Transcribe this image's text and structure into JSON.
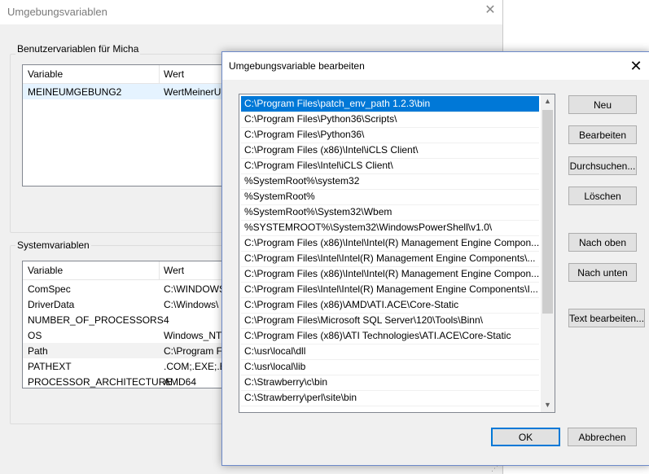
{
  "background_window": {
    "title": "Umgebungsvariablen",
    "user_group_label": "Benutzervariablen für Micha",
    "user_columns": [
      "Variable",
      "Wert"
    ],
    "user_rows": [
      {
        "variable": "MEINEUMGEBUNG2",
        "value": "WertMeinerU"
      }
    ],
    "system_group_label": "Systemvariablen",
    "system_columns": [
      "Variable",
      "Wert"
    ],
    "system_rows": [
      {
        "variable": "ComSpec",
        "value": "C:\\WINDOWS"
      },
      {
        "variable": "DriverData",
        "value": "C:\\Windows\\"
      },
      {
        "variable": "NUMBER_OF_PROCESSORS",
        "value": "4"
      },
      {
        "variable": "OS",
        "value": "Windows_NT"
      },
      {
        "variable": "Path",
        "value": "C:\\Program F"
      },
      {
        "variable": "PATHEXT",
        "value": ".COM;.EXE;.B"
      },
      {
        "variable": "PROCESSOR_ARCHITECTURE",
        "value": "AMD64"
      }
    ]
  },
  "dialog": {
    "title": "Umgebungsvariable bearbeiten",
    "paths": [
      "C:\\Program Files\\patch_env_path 1.2.3\\bin",
      "C:\\Program Files\\Python36\\Scripts\\",
      "C:\\Program Files\\Python36\\",
      "C:\\Program Files (x86)\\Intel\\iCLS Client\\",
      "C:\\Program Files\\Intel\\iCLS Client\\",
      "%SystemRoot%\\system32",
      "%SystemRoot%",
      "%SystemRoot%\\System32\\Wbem",
      "%SYSTEMROOT%\\System32\\WindowsPowerShell\\v1.0\\",
      "C:\\Program Files (x86)\\Intel\\Intel(R) Management Engine Compon...",
      "C:\\Program Files\\Intel\\Intel(R) Management Engine Components\\...",
      "C:\\Program Files (x86)\\Intel\\Intel(R) Management Engine Compon...",
      "C:\\Program Files\\Intel\\Intel(R) Management Engine Components\\I...",
      "C:\\Program Files (x86)\\AMD\\ATI.ACE\\Core-Static",
      "C:\\Program Files\\Microsoft SQL Server\\120\\Tools\\Binn\\",
      "C:\\Program Files (x86)\\ATI Technologies\\ATI.ACE\\Core-Static",
      "C:\\usr\\local\\dll",
      "C:\\usr\\local\\lib",
      "C:\\Strawberry\\c\\bin",
      "C:\\Strawberry\\perl\\site\\bin"
    ],
    "buttons": {
      "new": "Neu",
      "edit": "Bearbeiten",
      "browse": "Durchsuchen...",
      "delete": "Löschen",
      "move_up": "Nach oben",
      "move_down": "Nach unten",
      "edit_text": "Text bearbeiten...",
      "ok": "OK",
      "cancel": "Abbrechen"
    }
  }
}
